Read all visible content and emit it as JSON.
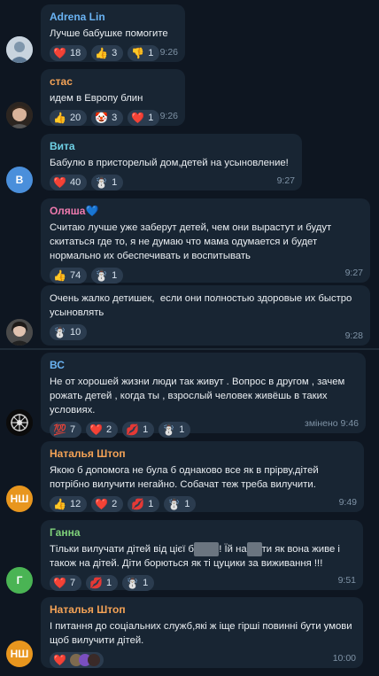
{
  "messages": [
    {
      "name": "Adrena Lin",
      "name_color": "#6ab3f3",
      "text": "Лучше бабушке помогите",
      "time": "9:26",
      "reactions": [
        {
          "icon": "red-heart",
          "emoji": "❤️",
          "count": "18"
        },
        {
          "icon": "thumbs-up",
          "emoji": "👍",
          "count": "3"
        },
        {
          "icon": "thumbs-down",
          "emoji": "👎",
          "count": "1"
        }
      ]
    },
    {
      "name": "стас",
      "name_color": "#f5a356",
      "text": "идем в Европу блин",
      "time": "9:26",
      "reactions": [
        {
          "icon": "thumbs-up",
          "emoji": "👍",
          "count": "20"
        },
        {
          "icon": "clown-face",
          "emoji": "🤡",
          "count": "3"
        },
        {
          "icon": "red-heart",
          "emoji": "❤️",
          "count": "1"
        }
      ]
    },
    {
      "name": "Вита",
      "name_color": "#6fd1e6",
      "avatar_letter": "В",
      "avatar_color": "#4a8fdb",
      "text": "Бабулю в присторелый дом,детей на усыновление!",
      "time": "9:27",
      "reactions": [
        {
          "icon": "red-heart",
          "emoji": "❤️",
          "count": "40"
        },
        {
          "icon": "snowman",
          "emoji": "☃️",
          "count": "1"
        }
      ]
    },
    {
      "name": "Оляша💙",
      "name_color": "#ee7aae",
      "text": "Считаю лучше уже заберут детей, чем они вырастут и будут скитаться где то, я не думаю что мама одумается и будет нормально их обеспечивать и воспитывать",
      "time": "9:27",
      "reactions": [
        {
          "icon": "thumbs-up",
          "emoji": "👍",
          "count": "74"
        },
        {
          "icon": "snowman",
          "emoji": "☃️",
          "count": "1"
        }
      ]
    },
    {
      "name": "",
      "text": "Очень жалко детишек,  если они полностью здоровые их быстро усыновлять",
      "time": "9:28",
      "reactions": [
        {
          "icon": "snowman",
          "emoji": "☃️",
          "count": "10"
        }
      ]
    },
    {
      "name": "ВС",
      "name_color": "#6ab3f3",
      "text": "Не от хорошей жизни люди так живут . Вопрос в другом , зачем рожать детей , когда ты , взрослый человек живёшь в таких условиях.",
      "time": "змінено 9:46",
      "reactions": [
        {
          "icon": "hundred-points",
          "emoji": "💯",
          "count": "7"
        },
        {
          "icon": "red-heart",
          "emoji": "❤️",
          "count": "2"
        },
        {
          "icon": "kiss-mark",
          "emoji": "💋",
          "count": "1"
        },
        {
          "icon": "snowman",
          "emoji": "☃️",
          "count": "1"
        }
      ]
    },
    {
      "name": "Наталья Штоп",
      "name_color": "#f5a356",
      "avatar_letter": "НШ",
      "avatar_color": "#e8961e",
      "text": "Якою б допомога не була б однаково все як в прірву,дітей потрібно вилучити негайно. Собачат теж треба вилучити.",
      "time": "9:49",
      "reactions": [
        {
          "icon": "thumbs-up",
          "emoji": "👍",
          "count": "12"
        },
        {
          "icon": "red-heart",
          "emoji": "❤️",
          "count": "2"
        },
        {
          "icon": "kiss-mark",
          "emoji": "💋",
          "count": "1"
        },
        {
          "icon": "snowman",
          "emoji": "☃️",
          "count": "1"
        }
      ]
    },
    {
      "name": "Ганна",
      "name_color": "#7fd27a",
      "avatar_letter": "Г",
      "avatar_color": "#4ab454",
      "text_parts": [
        "Тільки вилучати дітей від цієї б",
        "",
        "! Їй на",
        "",
        "ти як вона живе і також на дітей. Діти борються як ті цуцики за виживання !!!"
      ],
      "time": "9:51",
      "reactions": [
        {
          "icon": "red-heart",
          "emoji": "❤️",
          "count": "7"
        },
        {
          "icon": "kiss-mark",
          "emoji": "💋",
          "count": "1"
        },
        {
          "icon": "snowman",
          "emoji": "☃️",
          "count": "1"
        }
      ]
    },
    {
      "name": "Наталья Штоп",
      "name_color": "#f5a356",
      "avatar_letter": "НШ",
      "avatar_color": "#e8961e",
      "text": "І питання до соціальних служб,які ж іще гірші повинні бути умови щоб вилучити дітей.",
      "time": "10:00",
      "reactions": [
        {
          "icon": "red-heart",
          "emoji": "❤️",
          "count": ""
        }
      ]
    }
  ]
}
